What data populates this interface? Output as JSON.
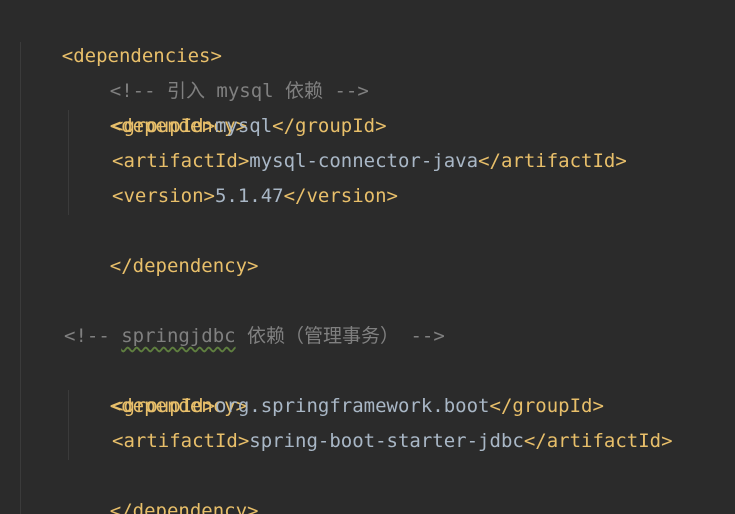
{
  "lines": {
    "deps_open": "<dependencies>",
    "comment_mysql": "<!-- 引入 mysql 依赖 -->",
    "dep1_open": "<dependency>",
    "dep1_group_open": "<groupId>",
    "dep1_group_val": "mysql",
    "dep1_group_close": "</groupId>",
    "dep1_artifact_open": "<artifactId>",
    "dep1_artifact_val": "mysql-connector-java",
    "dep1_artifact_close": "</artifactId>",
    "dep1_version_open": "<version>",
    "dep1_version_val": "5.1.47",
    "dep1_version_close": "</version>",
    "dep1_close": "</dependency>",
    "comment_spring_pre": "<!-- ",
    "comment_spring_word": "springjdbc",
    "comment_spring_post": " 依赖（管理事务） -->",
    "dep2_open": "<dependency>",
    "dep2_group_open": "<groupId>",
    "dep2_group_val": "org.springframework.boot",
    "dep2_group_close": "</groupId>",
    "dep2_artifact_open": "<artifactId>",
    "dep2_artifact_val": "spring-boot-starter-jdbc",
    "dep2_artifact_close": "</artifactId>",
    "dep2_close": "</dependency>"
  },
  "colors": {
    "background": "#2b2b2b",
    "tag": "#e8bf6a",
    "text": "#a9b7c6",
    "comment": "#808080",
    "indent_guide": "#3b3b3b"
  }
}
